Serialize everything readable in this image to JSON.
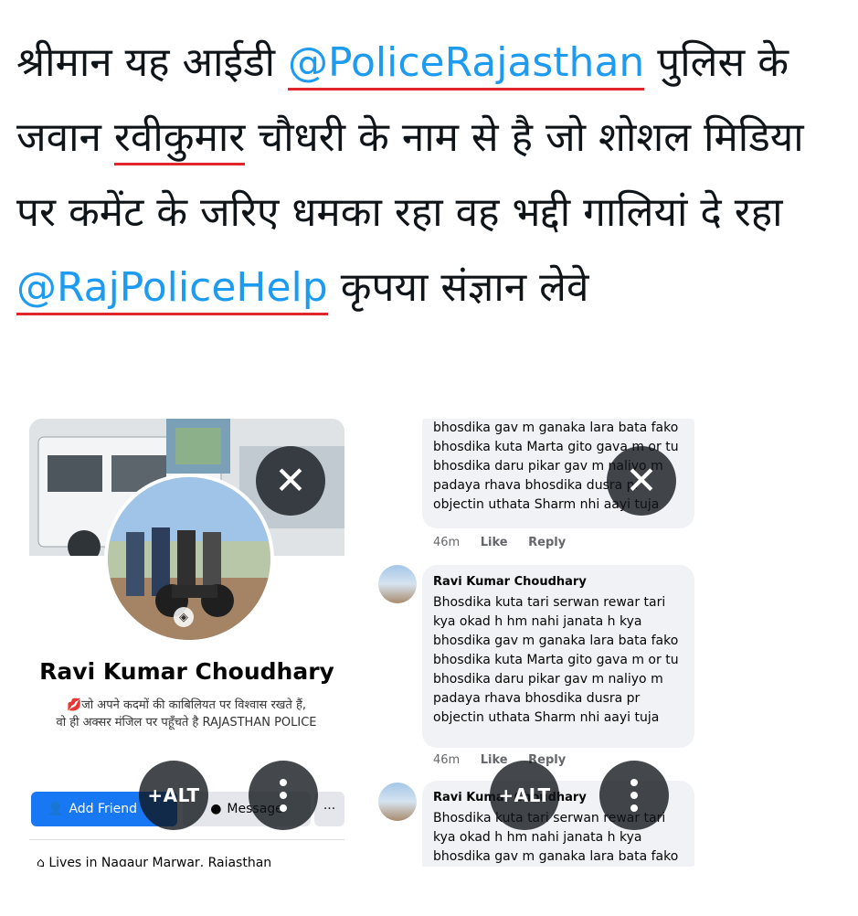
{
  "tweet": {
    "text_1": "श्रीमान यह आईडी ",
    "mention_1": "@PoliceRajasthan",
    "text_2": " पुलिस के जवान ",
    "name_highlight": "रवीकुमार",
    "text_3": " चौधरी के नाम से है जो शोशल मिडिया पर कमेंट के जरिए धमका रहा वह भद्दी गालियां दे रहा ",
    "mention_2": "@RajPoliceHelp",
    "text_4": " कृपया संज्ञान लेवे"
  },
  "profile_card": {
    "name": "Ravi Kumar Choudhary",
    "bio_line_1": "💋जो अपने कदमों की काबिलियत पर विश्वास रखते हैं,",
    "bio_line_2": "वो ही अक्सर मंजिल पर पहूँचते है RAJASTHAN POLICE",
    "add_friend_label": "Add Friend",
    "message_label": "Message",
    "more_label": "···",
    "lives_in": "Lives in Nagaur Marwar, Rajasthan"
  },
  "comments": [
    {
      "author": "",
      "text": "bhosdika gav m ganaka lara bata fako bhosdika kuta Marta gito gava m or tu bhosdika daru pikar gav m naliyo m padaya rhava bhosdika dusra pr objectin uthata Sharm nhi aayi tuja",
      "time": "46m",
      "like_label": "Like",
      "reply_label": "Reply"
    },
    {
      "author": "Ravi Kumar Choudhary",
      "text": "Bhosdika kuta tari serwan rewar tari kya okad h hm nahi janata h kya bhosdika gav m ganaka lara bata fako bhosdika kuta Marta gito gava m or tu bhosdika daru pikar gav m naliyo m padaya rhava bhosdika dusra pr objectin uthata Sharm nhi aayi tuja",
      "time": "46m",
      "like_label": "Like",
      "reply_label": "Reply"
    },
    {
      "author": "Ravi Kumar Choudhary",
      "text": "Bhosdika kuta tari serwan rewar tari kya okad h hm nahi janata h kya bhosdika gav m ganaka lara bata fako bhosdika kuta Marta gito gava",
      "time": "",
      "like_label": "",
      "reply_label": ""
    }
  ],
  "overlay": {
    "close_icon": "close-x-icon",
    "close_glyph": "✕",
    "alt_label": "+ALT",
    "more_icon": "vertical-ellipsis-icon"
  },
  "colors": {
    "mention": "#1d9bf0",
    "underline": "#e0262b",
    "fb_blue": "#1877f2",
    "overlay_bg": "#0f1419"
  }
}
